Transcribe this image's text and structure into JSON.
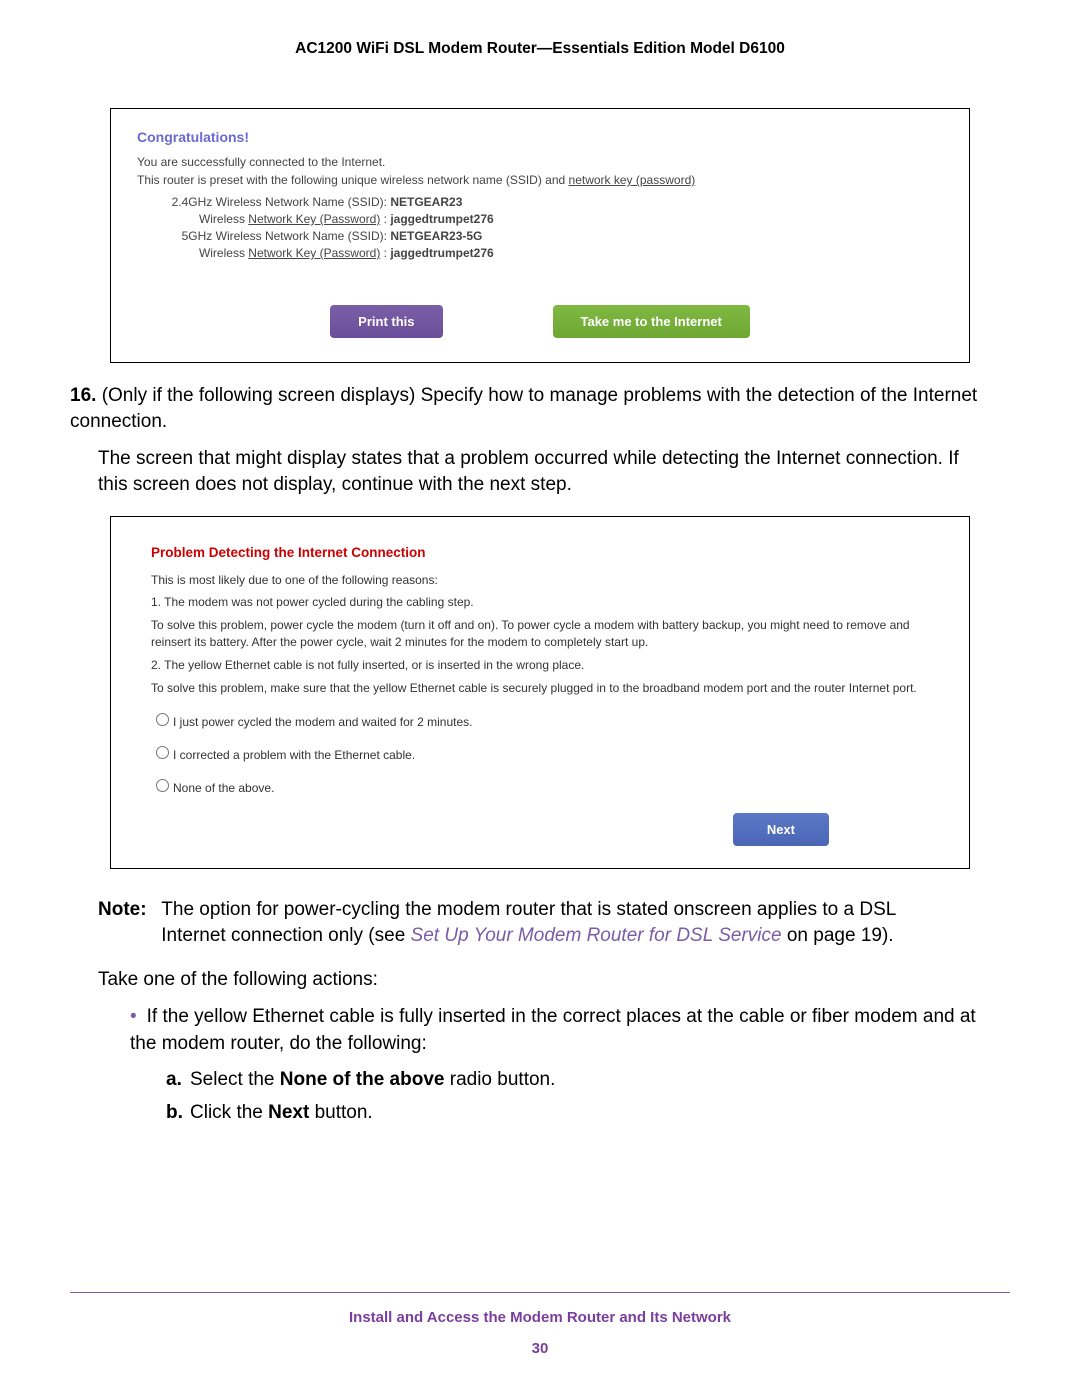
{
  "doc_title": "AC1200 WiFi DSL Modem Router—Essentials Edition Model D6100",
  "congrats": {
    "title": "Congratulations!",
    "line1": "You are successfully connected to the Internet.",
    "line2_pre": "This router is preset with the following unique wireless network name (SSID) and ",
    "line2_ul": "network key (password)",
    "ssid24_label": "2.4GHz Wireless Network Name (SSID):",
    "ssid24_value": "NETGEAR23",
    "key24_label_pre": "Wireless ",
    "key24_label_ul": "Network Key (Password)",
    "key24_label_post": " :",
    "key24_value": "jaggedtrumpet276",
    "ssid5_label": "5GHz Wireless Network Name (SSID):",
    "ssid5_value": "NETGEAR23-5G",
    "key5_value": "jaggedtrumpet276",
    "btn_print": "Print this",
    "btn_internet": "Take me to the Internet"
  },
  "step16": {
    "num": "16.",
    "text": " (Only if the following screen displays) Specify how to manage problems with the detection of the Internet connection.",
    "para": "The screen that might display states that a problem occurred while detecting the Internet connection. If this screen does not display, continue with the next step."
  },
  "problem": {
    "title": "Problem Detecting the Internet Connection",
    "intro": "This is most likely due to one of the following reasons:",
    "r1": "1.  The modem was not power cycled during the cabling step.",
    "r1b": "To solve this problem, power cycle the modem (turn it off and on). To power cycle a modem with battery backup, you might need to remove and reinsert its battery. After the power cycle, wait 2 minutes for the modem to completely start up.",
    "r2": "2.  The yellow Ethernet cable is not fully inserted, or is inserted in the wrong place.",
    "r2b": "To solve this problem, make sure that the yellow Ethernet cable is securely plugged in to the broadband modem port and the router Internet port.",
    "opt1": "I just power cycled the modem and waited for 2 minutes.",
    "opt2": "I corrected a problem with the Ethernet cable.",
    "opt3": "None of the above.",
    "btn_next": "Next"
  },
  "note": {
    "label": "Note:",
    "body_pre": "The option for power-cycling the modem router that is stated onscreen applies to a DSL Internet connection only (see ",
    "link": "Set Up Your Modem Router for DSL Service",
    "body_post": " on page 19)."
  },
  "actions": {
    "intro": "Take one of the following actions:",
    "bullet": "If the yellow Ethernet cable is fully inserted in the correct places at the cable or fiber modem and at the modem router, do the following:",
    "a_pre": "Select the ",
    "a_bold": "None of the above",
    "a_post": " radio button.",
    "b_pre": "Click the ",
    "b_bold": "Next",
    "b_post": " button."
  },
  "footer": {
    "section": "Install and Access the Modem Router and Its Network",
    "page": "30"
  }
}
